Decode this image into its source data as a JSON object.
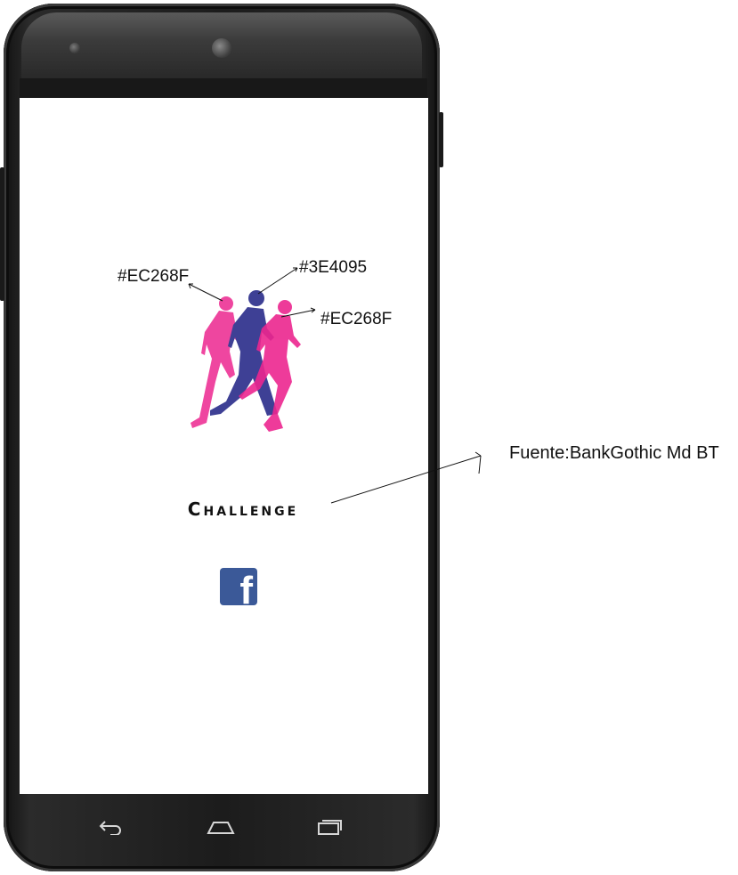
{
  "app": {
    "title": "Challenge"
  },
  "brand_logo": {
    "icon": "runners-logo-icon",
    "annotations": [
      "#EC268F",
      "#3E4095",
      "#EC268F"
    ]
  },
  "facebook_button": {
    "glyph": "f",
    "icon": "facebook-icon",
    "color": "#3B5998"
  },
  "font_note": "Fuente:BankGothic Md BT",
  "colors": {
    "pink": "#EC268F",
    "blue": "#3E4095"
  },
  "navigation": {
    "back_icon": "back-icon",
    "home_icon": "home-icon",
    "recents_icon": "recents-icon"
  }
}
